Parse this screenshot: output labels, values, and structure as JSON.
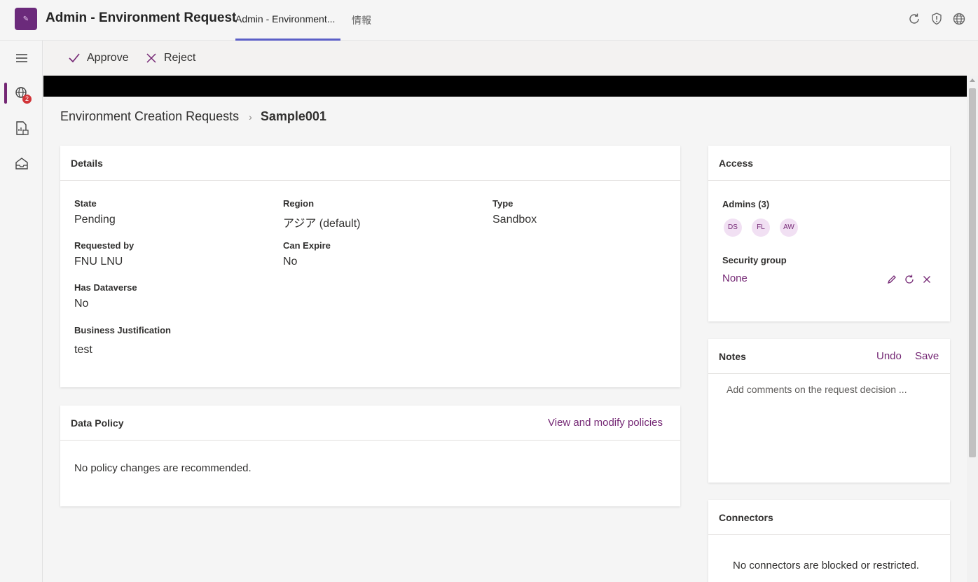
{
  "app": {
    "title": "Admin - Environment Request",
    "logo_glyph": "✎",
    "tabs": [
      {
        "label": "Admin - Environment..."
      },
      {
        "label": "情報"
      }
    ]
  },
  "rail": {
    "badge_count": "2"
  },
  "commands": {
    "approve": "Approve",
    "reject": "Reject"
  },
  "breadcrumb": {
    "root": "Environment Creation Requests",
    "current": "Sample001"
  },
  "details": {
    "title": "Details",
    "state_label": "State",
    "state_value": "Pending",
    "region_label": "Region",
    "region_value": "アジア (default)",
    "type_label": "Type",
    "type_value": "Sandbox",
    "requested_by_label": "Requested by",
    "requested_by_value": "FNU LNU",
    "can_expire_label": "Can Expire",
    "can_expire_value": "No",
    "has_dataverse_label": "Has Dataverse",
    "has_dataverse_value": "No",
    "justification_label": "Business Justification",
    "justification_value": "test"
  },
  "data_policy": {
    "title": "Data Policy",
    "link": "View and modify policies",
    "message": "No policy changes are recommended."
  },
  "access": {
    "title": "Access",
    "admins_label": "Admins (3)",
    "admins": [
      "DS",
      "FL",
      "AW"
    ],
    "security_group_label": "Security group",
    "security_group_value": "None"
  },
  "notes": {
    "title": "Notes",
    "undo": "Undo",
    "save": "Save",
    "placeholder": "Add comments on the request decision ..."
  },
  "connectors": {
    "title": "Connectors",
    "message": "No connectors are blocked or restricted."
  },
  "colors": {
    "accent": "#742774",
    "tab_underline": "#5b5fc7",
    "badge": "#d13438"
  }
}
